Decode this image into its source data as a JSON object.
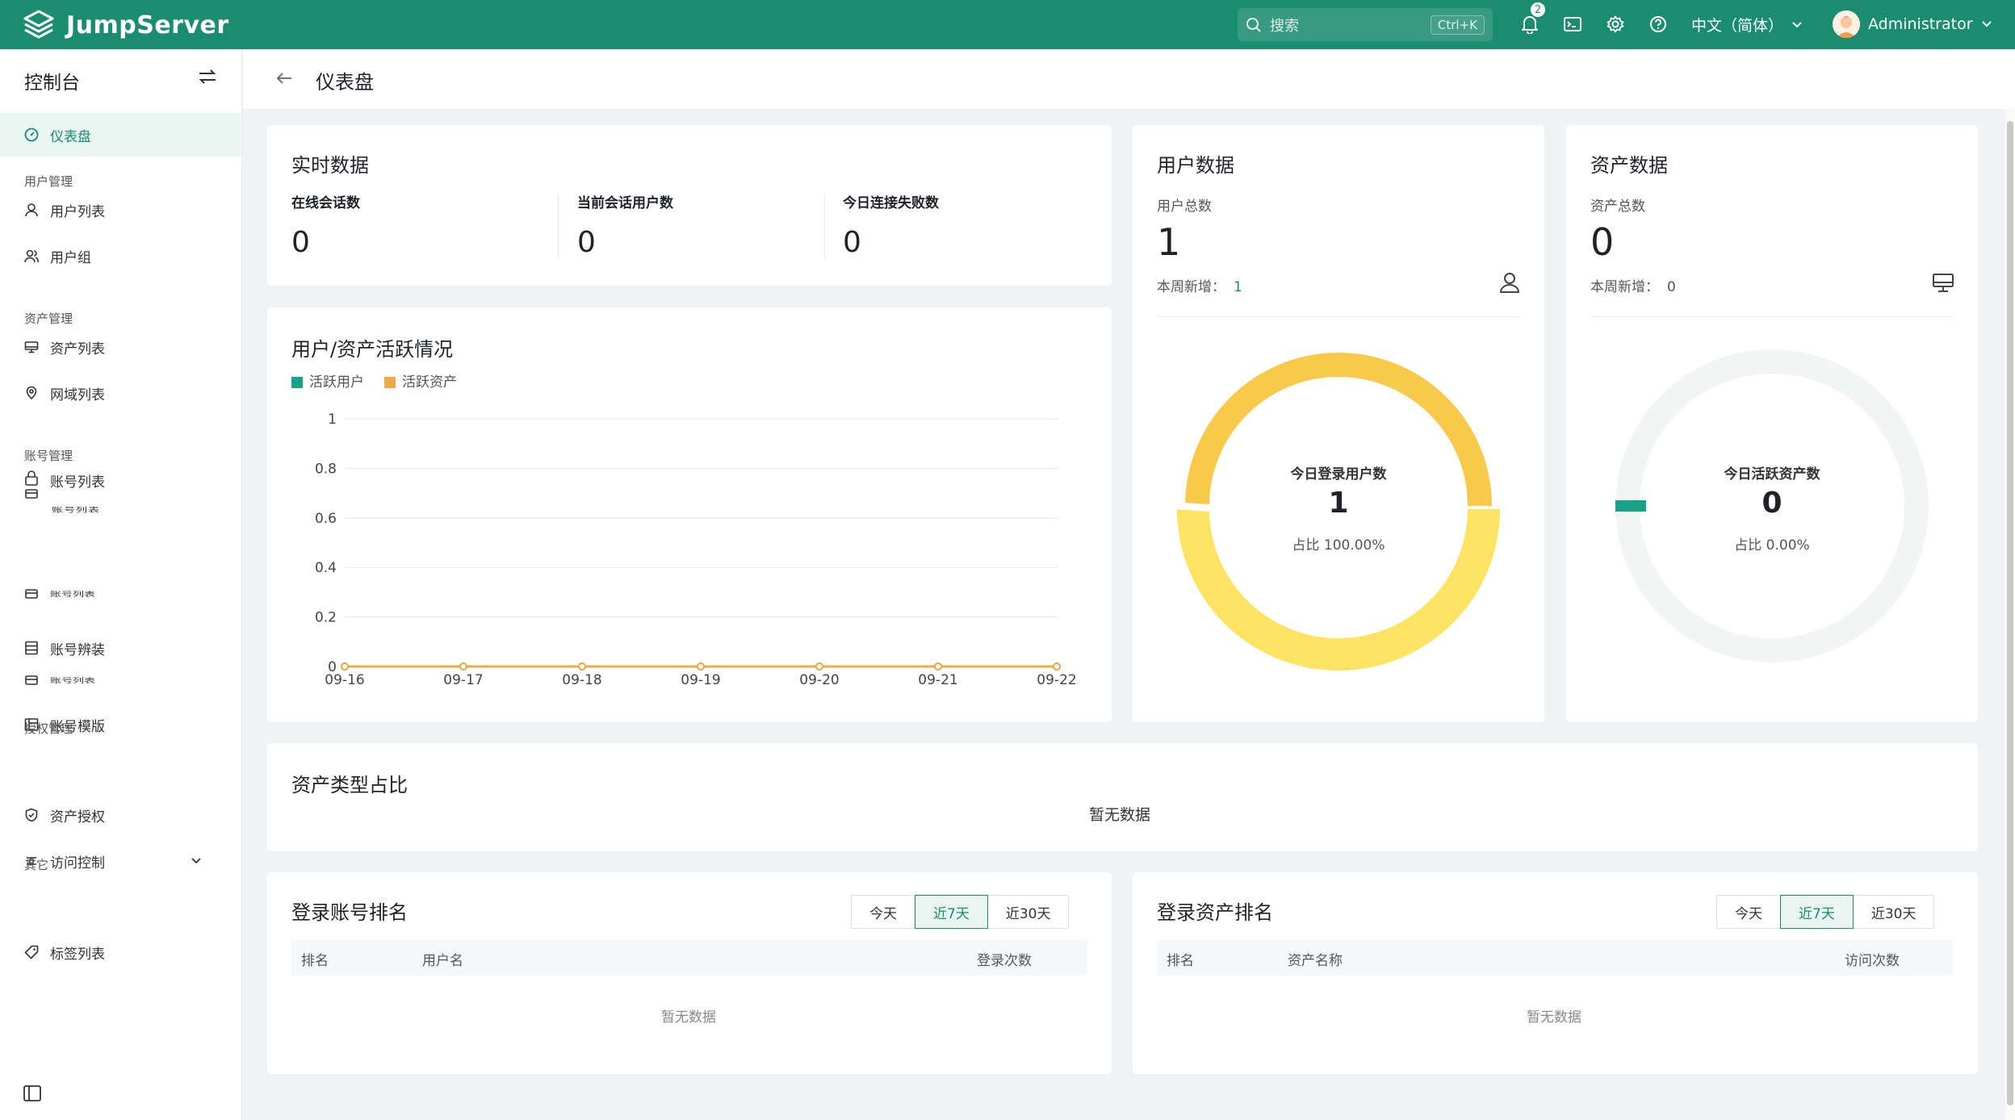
{
  "topbar": {
    "brand": "JumpServer",
    "search_placeholder": "搜索",
    "search_shortcut": "Ctrl+K",
    "notification_count": "2",
    "language": "中文（简体）",
    "username": "Administrator",
    "brand_color": "#1a8c6f"
  },
  "sidebar": {
    "title": "控制台",
    "items": [
      {
        "label": "仪表盘",
        "icon": "dashboard-icon",
        "active": true
      },
      {
        "group": "用户管理"
      },
      {
        "label": "用户列表",
        "icon": "user-icon"
      },
      {
        "label": "用户组",
        "icon": "user-group-icon"
      },
      {
        "group": "资产管理"
      },
      {
        "label": "资产列表",
        "icon": "monitor-icon"
      },
      {
        "label": "网域列表",
        "icon": "location-icon"
      },
      {
        "group": "账号管理"
      },
      {
        "label": "账号列表",
        "icon": "lock-icon"
      },
      {
        "label": "账号列表",
        "icon": "ghost-icon"
      },
      {
        "label": "账号列表",
        "icon": "ghost-icon"
      },
      {
        "label": "账号辨装",
        "icon": "stack-icon"
      },
      {
        "label": "账号列表",
        "icon": "ghost-icon"
      },
      {
        "label": "账号模版",
        "icon": "template-icon"
      },
      {
        "group": "授权管理"
      },
      {
        "label": "资产授权",
        "icon": "shield-icon"
      },
      {
        "label": "访问控制",
        "icon": "access-control-icon"
      },
      {
        "group": "其它"
      },
      {
        "label": "标签列表",
        "icon": "tag-icon"
      }
    ]
  },
  "header": {
    "title": "仪表盘"
  },
  "realtime": {
    "title": "实时数据",
    "online_sessions_label": "在线会话数",
    "online_sessions": "0",
    "current_users_label": "当前会话用户数",
    "current_users": "0",
    "failed_label": "今日连接失败数",
    "failed": "0"
  },
  "user_data": {
    "title": "用户数据",
    "total_label": "用户总数",
    "total": "1",
    "week_label": "本周新增：",
    "week_new": "1",
    "donut_label": "今日登录用户数",
    "donut_value": "1",
    "donut_ratio": "占比 100.00%",
    "ratio": 1.0
  },
  "asset_data": {
    "title": "资产数据",
    "total_label": "资产总数",
    "total": "0",
    "week_label": "本周新增：",
    "week_new": "0",
    "donut_label": "今日活跃资产数",
    "donut_value": "0",
    "donut_ratio": "占比 0.00%",
    "ratio": 0.0
  },
  "activity": {
    "title": "用户/资产活跃情况",
    "legend_users": "活跃用户",
    "legend_assets": "活跃资产",
    "color_users": "#1aa286",
    "color_assets": "#f0a94a"
  },
  "chart_data": {
    "type": "line",
    "title": "用户/资产活跃情况",
    "x": [
      "09-16",
      "09-17",
      "09-18",
      "09-19",
      "09-20",
      "09-21",
      "09-22"
    ],
    "series": [
      {
        "name": "活跃用户",
        "values": [
          0,
          0,
          0,
          0,
          0,
          0,
          0
        ]
      },
      {
        "name": "活跃资产",
        "values": [
          0,
          0,
          0,
          0,
          0,
          0,
          0
        ]
      }
    ],
    "yticks": [
      "0",
      "0.2",
      "0.4",
      "0.6",
      "0.8",
      "1"
    ],
    "ylim": [
      0,
      1
    ],
    "legend": "top-left",
    "grid": true
  },
  "asset_types": {
    "title": "资产类型占比",
    "empty": "暂无数据"
  },
  "login_rank": {
    "title": "登录账号排名",
    "tabs": [
      "今天",
      "近7天",
      "近30天"
    ],
    "col_rank": "排名",
    "col_name": "用户名",
    "col_count": "登录次数",
    "empty": "暂无数据"
  },
  "asset_rank": {
    "title": "登录资产排名",
    "tabs": [
      "今天",
      "近7天",
      "近30天"
    ],
    "col_rank": "排名",
    "col_name": "资产名称",
    "col_count": "访问次数",
    "empty": "暂无数据"
  }
}
